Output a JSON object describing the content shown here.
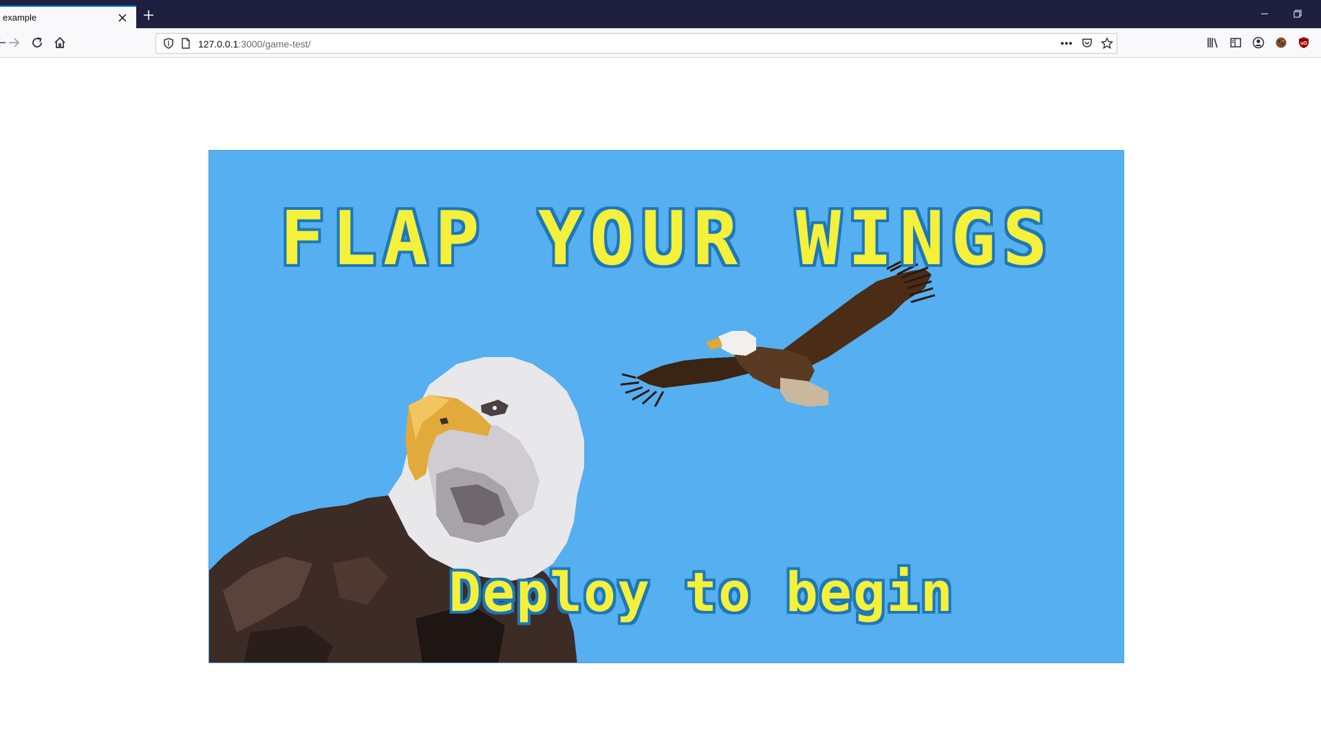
{
  "browser": {
    "tab_title": "example",
    "url_host": "127.0.0.1",
    "url_rest": ":3000/game-test/"
  },
  "game": {
    "title": "FLAP YOUR WINGS",
    "subtitle": "Deploy to begin",
    "colors": {
      "sky": "#56aff0",
      "text": "#f5f03a",
      "text_outline": "#1e78b8"
    }
  },
  "icons": {
    "back": "back-arrow-icon",
    "forward": "forward-arrow-icon",
    "reload": "reload-icon",
    "home": "home-icon",
    "shield": "shield-icon",
    "page": "page-icon",
    "more": "more-icon",
    "pocket": "pocket-icon",
    "bookmark": "star-icon",
    "library": "library-icon",
    "sidebar": "sidebar-icon",
    "account": "account-icon",
    "cookie": "cookie-icon",
    "ublock": "ublock-icon"
  }
}
